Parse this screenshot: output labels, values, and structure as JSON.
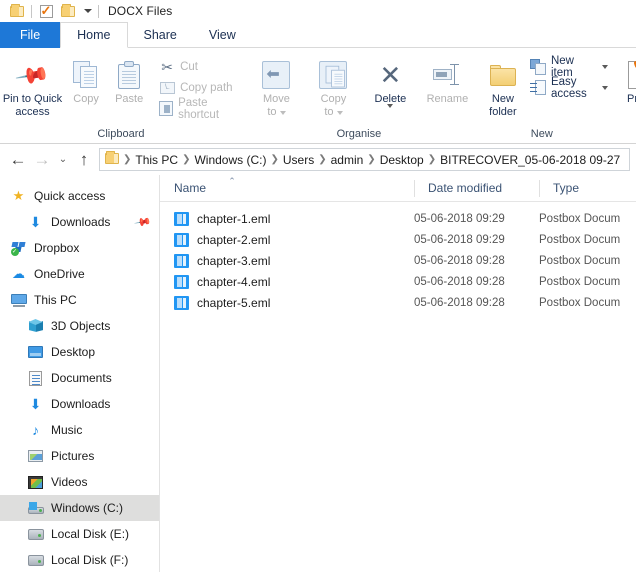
{
  "window": {
    "title": "DOCX Files",
    "qat": [
      {
        "name": "folder-icon",
        "label": "Folder"
      },
      {
        "name": "properties-icon",
        "label": "Properties"
      },
      {
        "name": "new-folder-icon",
        "label": "New folder"
      },
      {
        "name": "customize-caret-icon",
        "label": "Customize Quick Access Toolbar"
      }
    ]
  },
  "tabs": [
    {
      "label": "File",
      "state": "file"
    },
    {
      "label": "Home",
      "state": "active"
    },
    {
      "label": "Share",
      "state": "normal"
    },
    {
      "label": "View",
      "state": "normal"
    }
  ],
  "ribbon": {
    "groups": [
      {
        "label": "Clipboard",
        "big": [
          {
            "label": "Pin to Quick\naccess",
            "line1": "Pin to Quick",
            "line2": "access",
            "enabled": true
          },
          {
            "label": "Copy",
            "line1": "Copy",
            "line2": "",
            "enabled": false
          },
          {
            "label": "Paste",
            "line1": "Paste",
            "line2": "",
            "enabled": false
          }
        ],
        "small": [
          {
            "label": "Cut",
            "enabled": false
          },
          {
            "label": "Copy path",
            "enabled": false
          },
          {
            "label": "Paste shortcut",
            "enabled": false
          }
        ]
      },
      {
        "label": "Organise",
        "big": [
          {
            "label": "Move to",
            "line1": "Move",
            "line2": "to",
            "enabled": false,
            "caret": true
          },
          {
            "label": "Copy to",
            "line1": "Copy",
            "line2": "to",
            "enabled": false,
            "caret": true
          },
          {
            "label": "Delete",
            "line1": "Delete",
            "line2": "",
            "enabled": true,
            "caret": true
          },
          {
            "label": "Rename",
            "line1": "Rename",
            "line2": "",
            "enabled": false
          }
        ]
      },
      {
        "label": "New",
        "big": [
          {
            "label": "New folder",
            "line1": "New",
            "line2": "folder",
            "enabled": true
          }
        ],
        "small": [
          {
            "label": "New item",
            "enabled": true,
            "caret": true
          },
          {
            "label": "Easy access",
            "enabled": true,
            "caret": true
          }
        ]
      },
      {
        "label": "",
        "big": [
          {
            "label": "Prope",
            "line1": "Prope",
            "line2": "",
            "enabled": true,
            "caret": true
          }
        ]
      }
    ]
  },
  "addressbar": {
    "back_label": "Back",
    "forward_label": "Forward",
    "recent_label": "Recent locations",
    "up_label": "Up one level",
    "crumbs": [
      "This PC",
      "Windows (C:)",
      "Users",
      "admin",
      "Desktop",
      "BITRECOVER_05-06-2018 09-27"
    ]
  },
  "navpane": {
    "items": [
      {
        "label": "Quick access",
        "icon": "star-icon",
        "indent": 0,
        "selected": false,
        "pinned": false
      },
      {
        "label": "Downloads",
        "icon": "download-arrow-icon",
        "indent": 1,
        "selected": false,
        "pinned": true
      },
      {
        "label": "Dropbox",
        "icon": "dropbox-icon",
        "indent": 0,
        "selected": false,
        "pinned": false
      },
      {
        "label": "OneDrive",
        "icon": "onedrive-cloud-icon",
        "indent": 0,
        "selected": false,
        "pinned": false
      },
      {
        "label": "This PC",
        "icon": "this-pc-icon",
        "indent": 0,
        "selected": false,
        "pinned": false
      },
      {
        "label": "3D Objects",
        "icon": "3d-objects-icon",
        "indent": 1,
        "selected": false,
        "pinned": false
      },
      {
        "label": "Desktop",
        "icon": "desktop-icon",
        "indent": 1,
        "selected": false,
        "pinned": false
      },
      {
        "label": "Documents",
        "icon": "documents-icon",
        "indent": 1,
        "selected": false,
        "pinned": false
      },
      {
        "label": "Downloads",
        "icon": "download-arrow-icon",
        "indent": 1,
        "selected": false,
        "pinned": false
      },
      {
        "label": "Music",
        "icon": "music-note-icon",
        "indent": 1,
        "selected": false,
        "pinned": false
      },
      {
        "label": "Pictures",
        "icon": "pictures-icon",
        "indent": 1,
        "selected": false,
        "pinned": false
      },
      {
        "label": "Videos",
        "icon": "videos-icon",
        "indent": 1,
        "selected": false,
        "pinned": false
      },
      {
        "label": "Windows (C:)",
        "icon": "windows-drive-icon",
        "indent": 1,
        "selected": true,
        "pinned": false
      },
      {
        "label": "Local Disk (E:)",
        "icon": "hard-disk-icon",
        "indent": 1,
        "selected": false,
        "pinned": false
      },
      {
        "label": "Local Disk (F:)",
        "icon": "hard-disk-icon",
        "indent": 1,
        "selected": false,
        "pinned": false
      }
    ]
  },
  "filelist": {
    "columns": [
      {
        "label": "Name",
        "sorted": "asc"
      },
      {
        "label": "Date modified",
        "sorted": ""
      },
      {
        "label": "Type",
        "sorted": ""
      }
    ],
    "rows": [
      {
        "name": "chapter-1.eml",
        "date": "05-06-2018 09:29",
        "type": "Postbox Docum"
      },
      {
        "name": "chapter-2.eml",
        "date": "05-06-2018 09:29",
        "type": "Postbox Docum"
      },
      {
        "name": "chapter-3.eml",
        "date": "05-06-2018 09:28",
        "type": "Postbox Docum"
      },
      {
        "name": "chapter-4.eml",
        "date": "05-06-2018 09:28",
        "type": "Postbox Docum"
      },
      {
        "name": "chapter-5.eml",
        "date": "05-06-2018 09:28",
        "type": "Postbox Docum"
      }
    ]
  },
  "colors": {
    "file_tab_blue": "#1e78d7",
    "ribbon_text": "#1b2f52",
    "selection_gray": "#dededd",
    "eml_icon_blue": "#2196f3",
    "properties_orange": "#e8740c",
    "folder_yellow": "#f7d074"
  }
}
